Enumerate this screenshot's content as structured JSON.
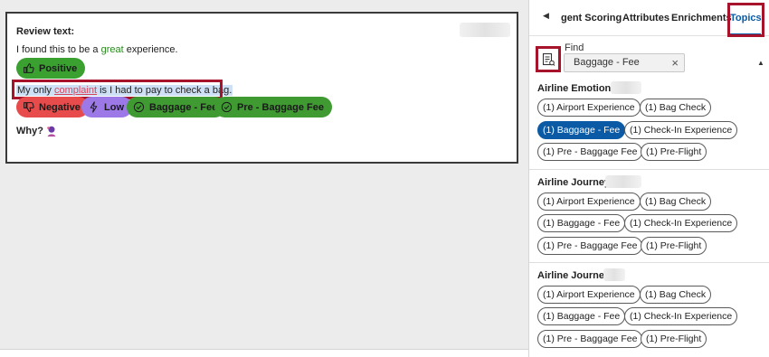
{
  "review": {
    "title": "Review text:",
    "sentence1_a": "I found this to be a ",
    "sentence1_hl": "great",
    "sentence1_b": " experience.",
    "positive_label": "Positive",
    "sentence2_a": "My only ",
    "sentence2_hl": "complaint",
    "sentence2_b": " is I had to pay to check a bag.",
    "tags": {
      "negative": "Negative",
      "low": "Low",
      "baggage_fee": "Baggage - Fee",
      "pre_baggage_fee": "Pre - Baggage Fee"
    },
    "why_label": "Why?"
  },
  "tabs": {
    "scoring": "gent Scoring",
    "attributes": "Attributes",
    "enrichments": "Enrichments",
    "topics": "Topics"
  },
  "find": {
    "label": "Find",
    "value": "Baggage - Fee",
    "clear": "×"
  },
  "sections": [
    {
      "title": "Airline Emotions",
      "chips": [
        "(1) Airport Experience",
        "(1) Bag Check",
        "(1) Baggage - Fee",
        "(1) Check-In Experience",
        "(1) Pre - Baggage Fee",
        "(1) Pre-Flight"
      ]
    },
    {
      "title": "Airline Journey",
      "chips": [
        "(1) Airport Experience",
        "(1) Bag Check",
        "(1) Baggage - Fee",
        "(1) Check-In Experience",
        "(1) Pre - Baggage Fee",
        "(1) Pre-Flight"
      ]
    },
    {
      "title": "Airline Journey",
      "chips": [
        "(1) Airport Experience",
        "(1) Bag Check",
        "(1) Baggage - Fee",
        "(1) Check-In Experience",
        "(1) Pre - Baggage Fee",
        "(1) Pre-Flight"
      ]
    }
  ],
  "colors": {
    "accent": "#0a5aa5",
    "highlight_outline": "#a8132c",
    "positive": "#3aa131",
    "negative": "#e84b4b",
    "low": "#9c79e6",
    "topic": "#3f9a31"
  }
}
